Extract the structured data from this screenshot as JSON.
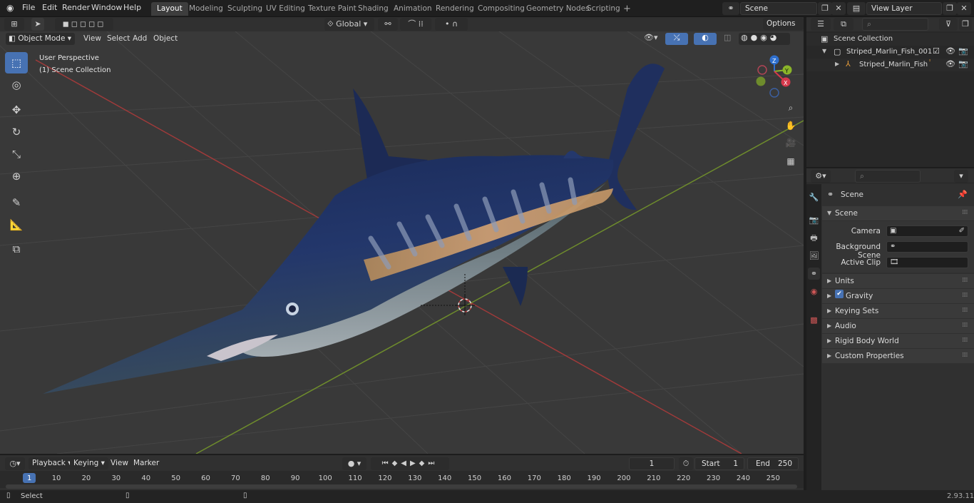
{
  "menu": {
    "file": "File",
    "edit": "Edit",
    "render": "Render",
    "window": "Window",
    "help": "Help"
  },
  "workspaces": [
    "Layout",
    "Modeling",
    "Sculpting",
    "UV Editing",
    "Texture Paint",
    "Shading",
    "Animation",
    "Rendering",
    "Compositing",
    "Geometry Nodes",
    "Scripting"
  ],
  "workspace_add": "+",
  "scene_field": "Scene",
  "view_layer_field": "View Layer",
  "viewport_header": {
    "mode": "Object Mode",
    "view": "View",
    "select": "Select",
    "add": "Add",
    "object": "Object",
    "orientation": "Global",
    "options": "Options"
  },
  "viewport_overlay": {
    "perspective": "User Perspective",
    "collection": "(1) Scene Collection"
  },
  "gizmo": {
    "x": "X",
    "y": "Y",
    "z": "Z"
  },
  "outliner": {
    "root": "Scene Collection",
    "collection": "Striped_Marlin_Fish_001",
    "object": "Striped_Marlin_Fish"
  },
  "properties": {
    "scene_title": "Scene",
    "panel_scene": "Scene",
    "camera_label": "Camera",
    "bg_scene_label": "Background Scene",
    "active_clip_label": "Active Clip",
    "panels": [
      "Units",
      "Gravity",
      "Keying Sets",
      "Audio",
      "Rigid Body World",
      "Custom Properties"
    ]
  },
  "timeline": {
    "playback": "Playback",
    "keying": "Keying",
    "view": "View",
    "marker": "Marker",
    "current_frame": "1",
    "start_label": "Start",
    "start_value": "1",
    "end_label": "End",
    "end_value": "250",
    "ticks": [
      "1",
      "10",
      "20",
      "30",
      "40",
      "50",
      "60",
      "70",
      "80",
      "90",
      "100",
      "110",
      "120",
      "130",
      "140",
      "150",
      "160",
      "170",
      "180",
      "190",
      "200",
      "210",
      "220",
      "230",
      "240",
      "250"
    ]
  },
  "status": {
    "select": "Select",
    "version": "2.93.11"
  },
  "colors": {
    "accent": "#4772b3",
    "x_axis": "#a03a3a",
    "y_axis": "#6e8c2c"
  }
}
